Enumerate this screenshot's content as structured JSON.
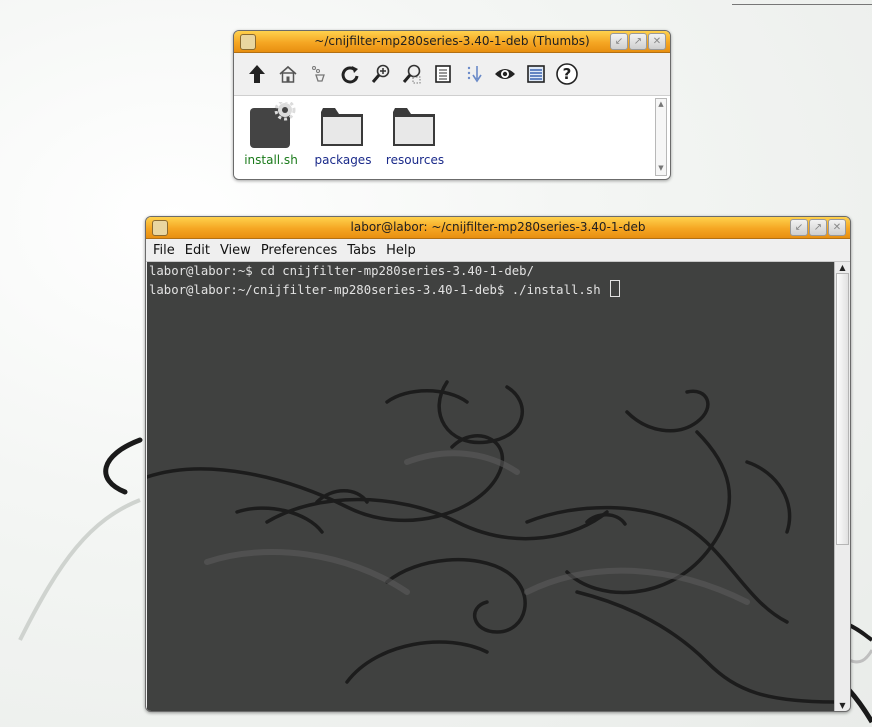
{
  "file_manager": {
    "title": "~/cnijfilter-mp280series-3.40-1-deb (Thumbs)",
    "toolbar": [
      {
        "name": "up-arrow-icon"
      },
      {
        "name": "home-icon"
      },
      {
        "name": "bookmarks-icon"
      },
      {
        "name": "refresh-icon"
      },
      {
        "name": "zoom-in-icon"
      },
      {
        "name": "zoom-out-icon"
      },
      {
        "name": "list-view-icon"
      },
      {
        "name": "sort-icon"
      },
      {
        "name": "show-hidden-eye-icon"
      },
      {
        "name": "details-view-icon"
      },
      {
        "name": "help-icon"
      }
    ],
    "items": [
      {
        "label": "install.sh",
        "type": "executable"
      },
      {
        "label": "packages",
        "type": "folder"
      },
      {
        "label": "resources",
        "type": "folder"
      }
    ]
  },
  "terminal": {
    "title": "labor@labor: ~/cnijfilter-mp280series-3.40-1-deb",
    "menu": [
      "File",
      "Edit",
      "View",
      "Preferences",
      "Tabs",
      "Help"
    ],
    "lines": [
      "labor@labor:~$ cd cnijfilter-mp280series-3.40-1-deb/",
      "labor@labor:~/cnijfilter-mp280series-3.40-1-deb$ ./install.sh "
    ]
  },
  "colors": {
    "titlebar_accent": "#f5a623",
    "terminal_background": "#404140",
    "terminal_text": "#e2e2e2",
    "executable_label": "#1a7a1a",
    "folder_label": "#1a2a8a"
  }
}
